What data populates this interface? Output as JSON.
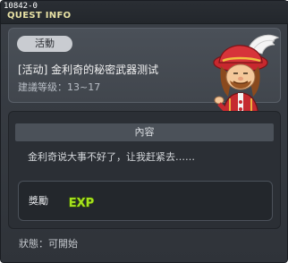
{
  "window": {
    "id_text": "10842-0",
    "title": "QUEST INFO"
  },
  "quest": {
    "tag": "活動",
    "name": "[活动] 金利奇的秘密武器测试",
    "level": "建議等级：13~17",
    "npc_icon": "npc-merchant-red-hat-portrait"
  },
  "content": {
    "header": "內容",
    "text": "金利奇说大事不好了，让我赶紧去……"
  },
  "reward": {
    "label": "獎勵",
    "exp_text": "EXP",
    "exp_icon": "exp-icon"
  },
  "status": {
    "text": "狀態：可開始"
  },
  "colors": {
    "title": "#e8e2a5",
    "exp": "#a6e11e"
  }
}
